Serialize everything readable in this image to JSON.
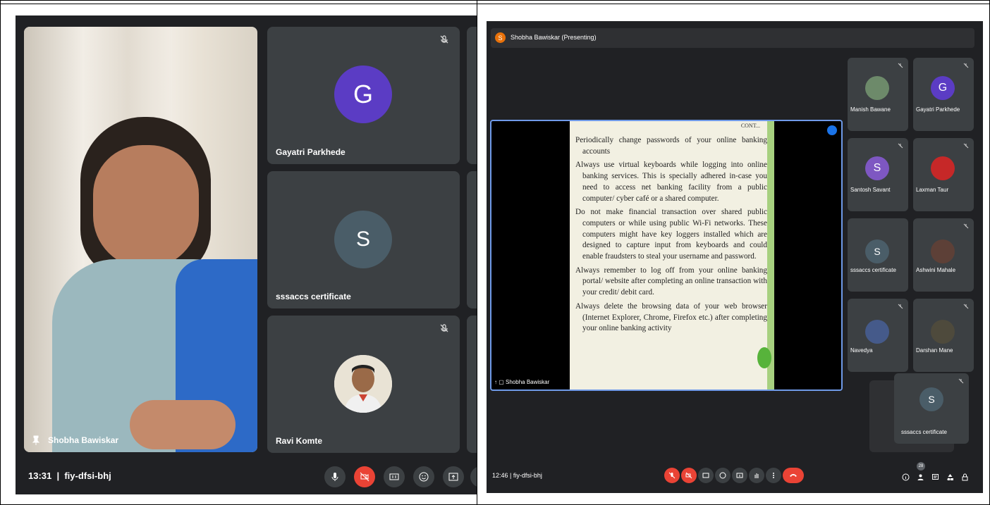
{
  "left_meet": {
    "time": "13:31",
    "meeting_code": "fiy-dfsi-bhj",
    "main_video_name": "Shobha Bawiskar",
    "tiles": [
      {
        "name": "Gayatri Parkhede",
        "initial": "G",
        "color": "#5b3cc4"
      },
      {
        "name": "sssaccs certificate",
        "initial": "S",
        "color": "#4a5d68"
      },
      {
        "name": "Ravi Komte"
      }
    ]
  },
  "right_meet": {
    "presenting": "Shobha Bawiskar (Presenting)",
    "presenter_initial": "S",
    "share_name": "Shobha Bawiskar",
    "time": "12:46",
    "meeting_code": "fiy-dfsi-bhj",
    "participant_count": "28",
    "slide": {
      "title": "CONT...",
      "bullets": [
        "Periodically change passwords of your online banking accounts",
        "Always use virtual keyboards while logging into online banking services. This is specially adhered in-case you need to access net banking facility from a public computer/ cyber café or a shared computer.",
        "Do not make financial transaction over shared public computers or while using public Wi-Fi networks. These computers might have key loggers installed which are designed to capture input from keyboards and could enable fraudsters to steal your username and password.",
        "Always remember to log off from your online banking portal/ website after completing an online transaction with your credit/ debit card.",
        "Always delete the browsing data of your web browser (Internet Explorer, Chrome, Firefox etc.) after completing your online banking activity"
      ]
    },
    "participants": [
      {
        "name": "Manish Bawane"
      },
      {
        "name": "Gayatri Parkhede",
        "initial": "G"
      },
      {
        "name": "Santosh Savant",
        "initial": "S"
      },
      {
        "name": "Laxman Taur"
      },
      {
        "name": "sssaccs certificate",
        "initial": "S"
      },
      {
        "name": "Ashwini Mahale"
      },
      {
        "name": "Navedya"
      },
      {
        "name": "Darshan Mane"
      }
    ],
    "floating_tile": {
      "name": "sssaccs certificate",
      "initial": "S"
    }
  }
}
